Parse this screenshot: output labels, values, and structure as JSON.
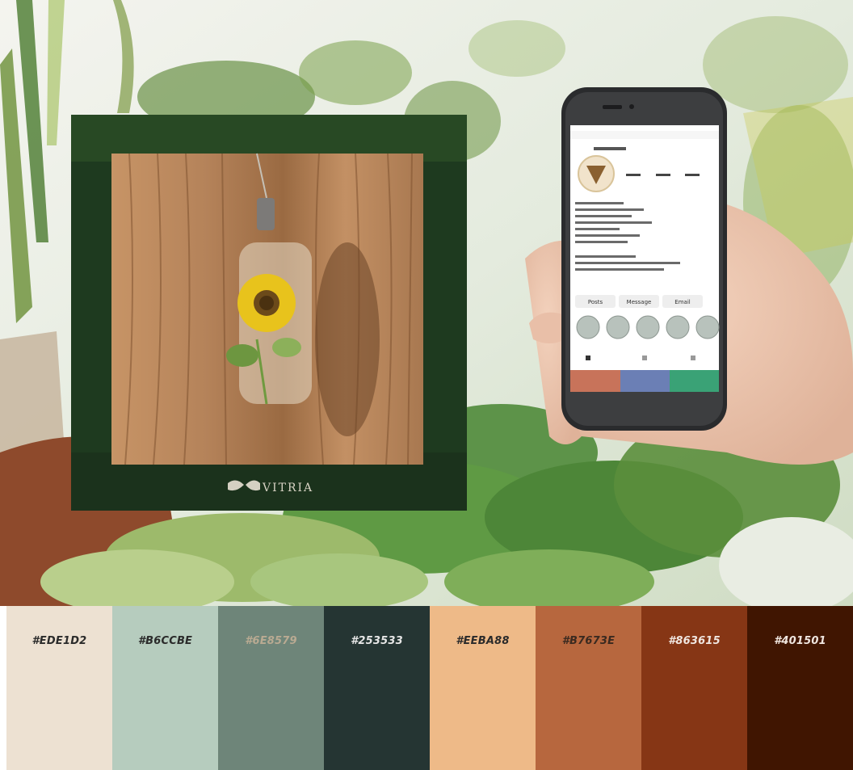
{
  "brand": {
    "name": "VITRIA"
  },
  "profile_screen": {
    "tabs": [
      "Posts",
      "Message",
      "Email"
    ]
  },
  "palette": [
    {
      "hex": "#EDE1D2",
      "color": "#EDE1D2",
      "text_color": "#2b2b2b"
    },
    {
      "hex": "#B6CCBE",
      "color": "#B6CCBE",
      "text_color": "#2b2b2b"
    },
    {
      "hex": "#6E8579",
      "color": "#6E8579",
      "text_color": "#b9aa92"
    },
    {
      "hex": "#253533",
      "color": "#253533",
      "text_color": "#e6e6e6"
    },
    {
      "hex": "#EEBA88",
      "color": "#EEBA88",
      "text_color": "#2b2b2b"
    },
    {
      "hex": "#B7673E",
      "color": "#B7673E",
      "text_color": "#3a2a20"
    },
    {
      "hex": "#863615",
      "color": "#863615",
      "text_color": "#f0e6e0"
    },
    {
      "hex": "#401501",
      "color": "#401501",
      "text_color": "#f0e6e0"
    }
  ]
}
